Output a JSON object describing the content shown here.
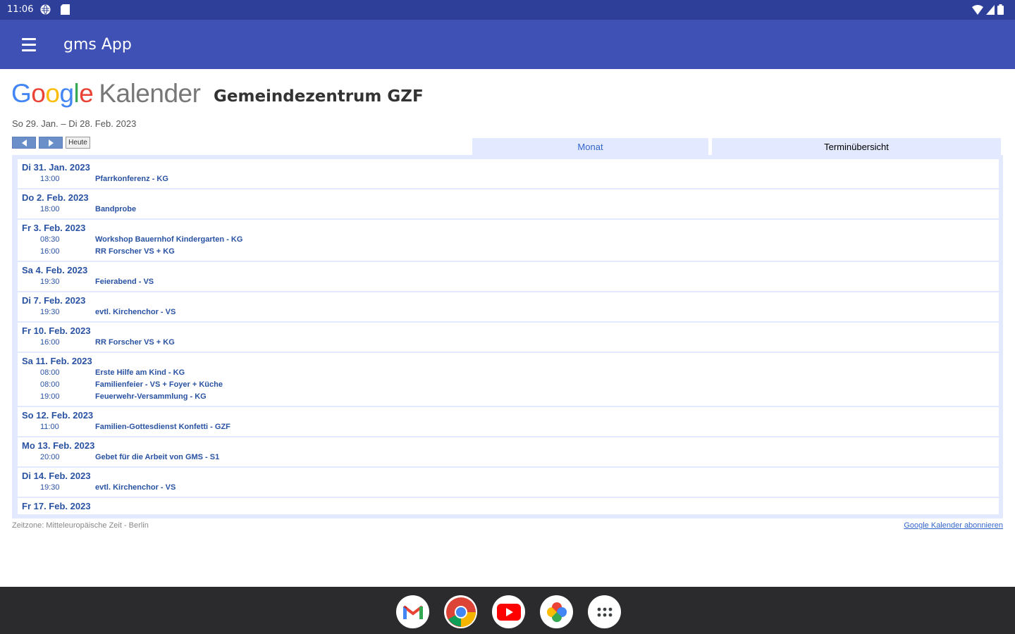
{
  "status_bar": {
    "time": "11:06"
  },
  "app_bar": {
    "title": "gms App"
  },
  "calendar": {
    "logo_word": "Google",
    "logo_suffix": "Kalender",
    "title": "Gemeindezentrum GZF",
    "date_range": "So 29. Jan. – Di 28. Feb. 2023",
    "today_label": "Heute",
    "tabs": [
      {
        "label": "Monat",
        "active": false
      },
      {
        "label": "Terminübersicht",
        "active": true
      }
    ],
    "days": [
      {
        "date": "Di 31. Jan. 2023",
        "events": [
          {
            "time": "13:00",
            "title": "Pfarrkonferenz - KG"
          }
        ]
      },
      {
        "date": "Do 2. Feb. 2023",
        "events": [
          {
            "time": "18:00",
            "title": "Bandprobe"
          }
        ]
      },
      {
        "date": "Fr 3. Feb. 2023",
        "events": [
          {
            "time": "08:30",
            "title": "Workshop Bauernhof Kindergarten - KG"
          },
          {
            "time": "16:00",
            "title": "RR Forscher VS + KG"
          }
        ]
      },
      {
        "date": "Sa 4. Feb. 2023",
        "events": [
          {
            "time": "19:30",
            "title": "Feierabend - VS"
          }
        ]
      },
      {
        "date": "Di 7. Feb. 2023",
        "events": [
          {
            "time": "19:30",
            "title": "evtl. Kirchenchor - VS"
          }
        ]
      },
      {
        "date": "Fr 10. Feb. 2023",
        "events": [
          {
            "time": "16:00",
            "title": "RR Forscher VS + KG"
          }
        ]
      },
      {
        "date": "Sa 11. Feb. 2023",
        "events": [
          {
            "time": "08:00",
            "title": "Erste Hilfe am Kind - KG"
          },
          {
            "time": "08:00",
            "title": "Familienfeier - VS + Foyer + Küche"
          },
          {
            "time": "19:00",
            "title": "Feuerwehr-Versammlung - KG"
          }
        ]
      },
      {
        "date": "So 12. Feb. 2023",
        "events": [
          {
            "time": "11:00",
            "title": "Familien-Gottesdienst Konfetti - GZF"
          }
        ]
      },
      {
        "date": "Mo 13. Feb. 2023",
        "events": [
          {
            "time": "20:00",
            "title": "Gebet für die Arbeit von GMS - S1"
          }
        ]
      },
      {
        "date": "Di 14. Feb. 2023",
        "events": [
          {
            "time": "19:30",
            "title": "evtl. Kirchenchor - VS"
          }
        ]
      },
      {
        "date": "Fr 17. Feb. 2023",
        "events": []
      }
    ],
    "timezone_text": "Zeitzone: Mitteleuropäische Zeit - Berlin",
    "subscribe_link": "Google Kalender abonnieren"
  },
  "dock": {
    "apps": [
      {
        "name": "gmail",
        "icon": "gmail-icon"
      },
      {
        "name": "chrome",
        "icon": "chrome-icon"
      },
      {
        "name": "youtube",
        "icon": "youtube-icon"
      },
      {
        "name": "photos",
        "icon": "photos-icon"
      },
      {
        "name": "app-drawer",
        "icon": "apps-grid-icon"
      }
    ]
  },
  "colors": {
    "status_bar": "#2e3f99",
    "app_bar": "#3f51b5",
    "calendar_blue": "#2952a3",
    "frame_light": "#e3e9ff",
    "nav_bar": "#2b2b2e"
  }
}
